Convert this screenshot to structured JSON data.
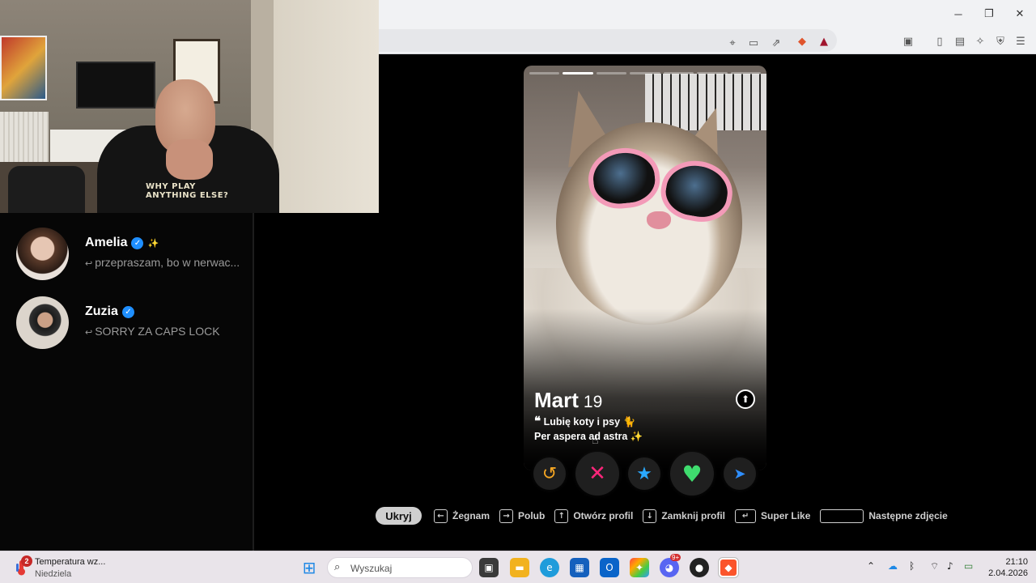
{
  "browser": {
    "window_controls": {
      "minimize": "─",
      "restore": "❐",
      "close": "✕"
    },
    "toolbar_icons": [
      "location-icon",
      "cast-icon",
      "share-icon",
      "brave-shield-icon",
      "brave-rewards-icon",
      "reader-icon",
      "sidebar-icon",
      "wallet-icon",
      "leo-ai-icon",
      "vpn-icon",
      "menu-icon"
    ],
    "shield_badge": "2"
  },
  "webcam": {
    "shirt_text": "WHY PLAY\nANYTHING ELSE?"
  },
  "chats": [
    {
      "name": "Amelia",
      "emoji": "✨",
      "message": "przepraszam, bo w nerwac..."
    },
    {
      "name": "Zuzia",
      "emoji": "",
      "message": "SORRY ZA CAPS LOCK"
    }
  ],
  "profile": {
    "name": "Mart",
    "age": "19",
    "bio_line1": "Lubię koty i psy 🐈",
    "bio_line2": "Per aspera ad astra ✨",
    "photo_count": 7,
    "active_photo": 2
  },
  "actions": {
    "rewind": "↺",
    "nope": "✕",
    "super_like": "★",
    "like": "♥",
    "boost": "➤"
  },
  "hints": {
    "hide": "Ukryj",
    "nope": "Żegnam",
    "like": "Polub",
    "open": "Otwórz profil",
    "close": "Zamknij profil",
    "superlike": "Super Like",
    "next": "Następne zdjęcie"
  },
  "taskbar": {
    "weather_title": "Temperatura wz...",
    "weather_sub": "Niedziela",
    "weather_badge": "2",
    "search_placeholder": "Wyszukaj",
    "discord_badge": "9+",
    "time": "21:10",
    "date": "2.04.2026"
  },
  "colors": {
    "nope": "#fd267a",
    "rewind": "#f5a623",
    "super_like": "#2aa9ff",
    "like": "#3fdc6e",
    "boost": "#2f8fff"
  }
}
